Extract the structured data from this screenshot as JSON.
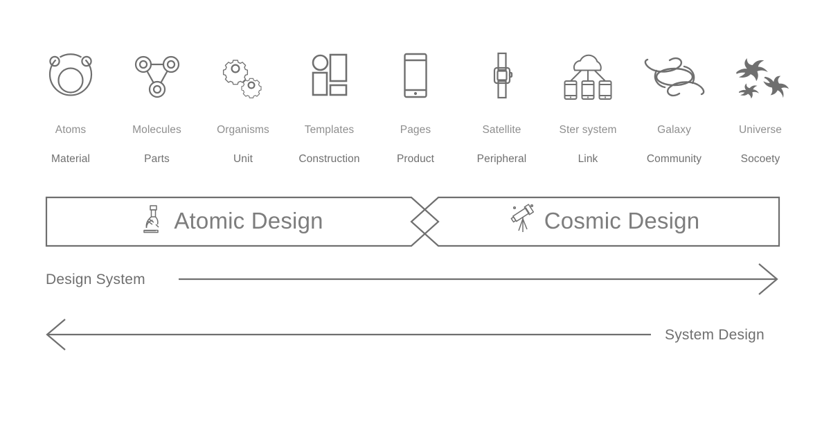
{
  "diagram": {
    "title": "Atomic Design / Cosmic Design scale diagram",
    "stroke_color": "#6f6f6f",
    "label_top_color": "#8e8e8e",
    "label_bottom_color": "#6f6f6f",
    "background_color": "#ffffff"
  },
  "columns": [
    {
      "icon": "atom-icon",
      "top_label": "Atoms",
      "bottom_label": "Material"
    },
    {
      "icon": "molecule-icon",
      "top_label": "Molecules",
      "bottom_label": "Parts"
    },
    {
      "icon": "gears-icon",
      "top_label": "Organisms",
      "bottom_label": "Unit"
    },
    {
      "icon": "wireframe-icon",
      "top_label": "Templates",
      "bottom_label": "Construction"
    },
    {
      "icon": "smartphone-icon",
      "top_label": "Pages",
      "bottom_label": "Product"
    },
    {
      "icon": "smartwatch-icon",
      "top_label": "Satellite",
      "bottom_label": "Peripheral"
    },
    {
      "icon": "cloud-devices-icon",
      "top_label": "Ster system",
      "bottom_label": "Link"
    },
    {
      "icon": "galaxy-icon",
      "top_label": "Galaxy",
      "bottom_label": "Community"
    },
    {
      "icon": "universe-icon",
      "top_label": "Universe",
      "bottom_label": "Socoety"
    }
  ],
  "banners": {
    "left": {
      "label": "Atomic Design",
      "icon": "microscope-icon"
    },
    "right": {
      "label": "Cosmic Design",
      "icon": "telescope-icon"
    }
  },
  "axes": {
    "top": {
      "label": "Design System",
      "direction": "right",
      "icon": "arrow-right-icon"
    },
    "bottom": {
      "label": "System Design",
      "direction": "left",
      "icon": "arrow-left-icon"
    }
  }
}
